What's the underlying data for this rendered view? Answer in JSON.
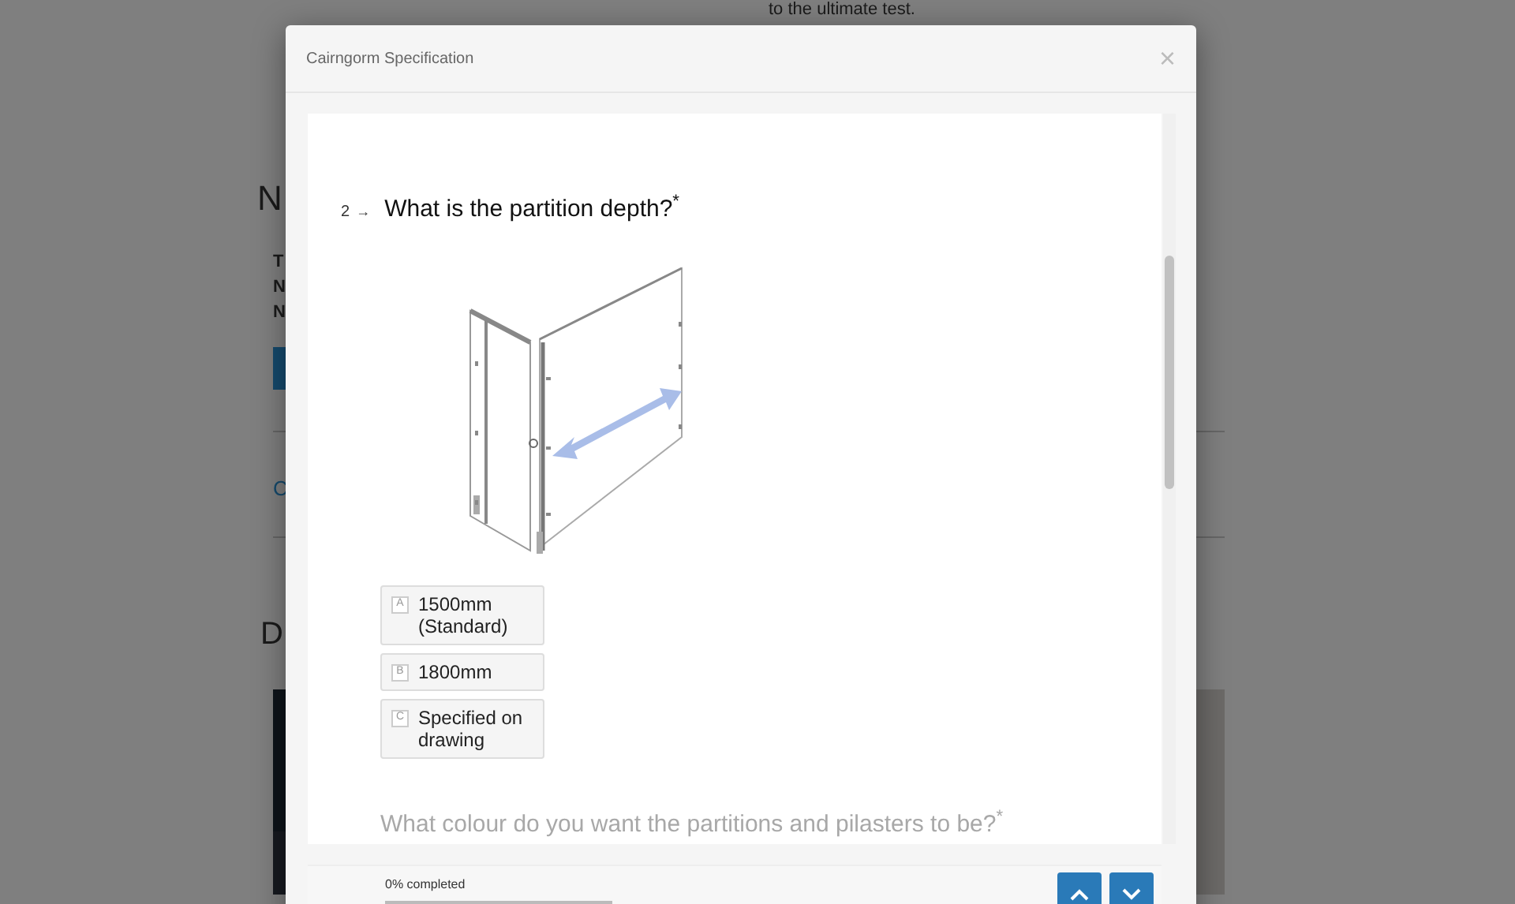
{
  "background_page": {
    "intro_text": "to the ultimate test.",
    "heading": "N",
    "lines": [
      "T",
      "N",
      "N"
    ],
    "link": "C",
    "section_heading": "D"
  },
  "modal": {
    "title": "Cairngorm Specification",
    "close": "×",
    "question": {
      "number": "2",
      "arrow": "→",
      "text": "What is the partition depth?",
      "required_mark": "*",
      "options": [
        {
          "key": "A",
          "label": "1500mm (Standard)",
          "selected": false
        },
        {
          "key": "B",
          "label": "1800mm",
          "selected": false
        },
        {
          "key": "C",
          "label": "Specified on drawing",
          "selected": false
        }
      ]
    },
    "next_question": {
      "text": "What colour do you want the partitions and pilasters to be?",
      "required_mark": "*"
    },
    "footer": {
      "progress_text": "0% completed",
      "level": 0
    }
  }
}
